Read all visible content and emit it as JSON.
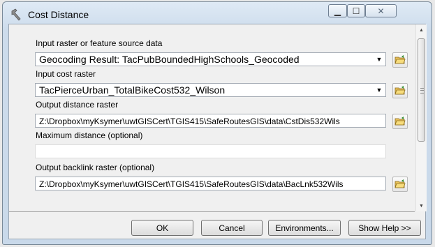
{
  "window": {
    "title": "Cost Distance"
  },
  "params": [
    {
      "label": "Input raster or feature source data",
      "value": "Geocoding Result: TacPubBoundedHighSchools_Geocoded"
    },
    {
      "label": "Input cost raster",
      "value": "TacPierceUrban_TotalBikeCost532_Wilson"
    },
    {
      "label": "Output distance raster",
      "value": "Z:\\Dropbox\\myKsymer\\uwtGISCert\\TGIS415\\SafeRoutesGIS\\data\\CstDis532Wils"
    },
    {
      "label": "Maximum distance (optional)",
      "value": ""
    },
    {
      "label": "Output backlink raster (optional)",
      "value": "Z:\\Dropbox\\myKsymer\\uwtGISCert\\TGIS415\\SafeRoutesGIS\\data\\BacLnk532Wils"
    }
  ],
  "buttons": {
    "ok": "OK",
    "cancel": "Cancel",
    "environments": "Environments...",
    "show_help": "Show Help >>"
  },
  "icons": {
    "title": "hammer-tool-icon",
    "browse": "folder-open-icon",
    "dropdown": "chevron-down-icon"
  }
}
